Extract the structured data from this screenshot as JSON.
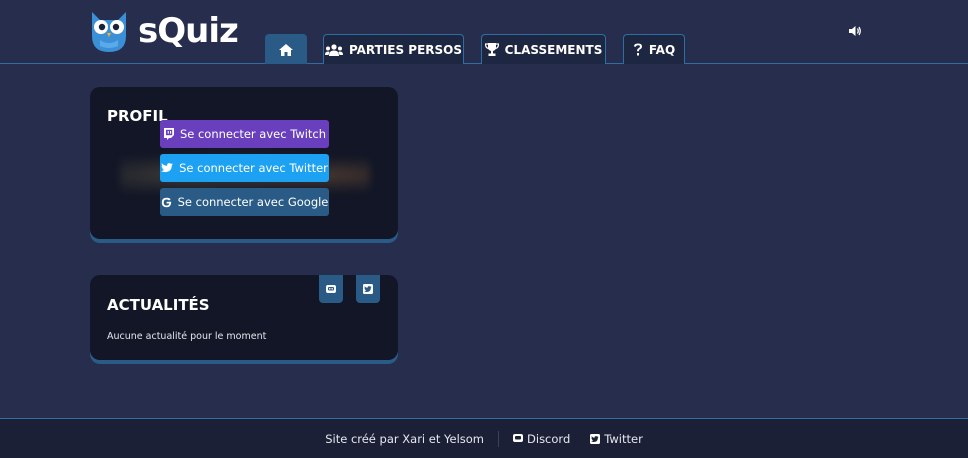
{
  "brand": {
    "name": "sQuiz"
  },
  "nav": {
    "tabs": [
      {
        "label": "",
        "icon": "home-icon",
        "active": true
      },
      {
        "label": "PARTIES PERSOS",
        "icon": "users-icon"
      },
      {
        "label": "CLASSEMENTS",
        "icon": "trophy-icon"
      },
      {
        "label": "FAQ",
        "icon": "question-icon"
      }
    ],
    "sound_icon": "volume-icon"
  },
  "profile": {
    "title": "PROFIL",
    "buttons": {
      "twitch": "Se connecter avec Twitch",
      "twitter": "Se connecter avec Twitter",
      "google": "Se connecter avec Google"
    }
  },
  "news": {
    "title": "ACTUALITÉS",
    "empty_text": "Aucune actualité pour le moment",
    "social_icons": [
      "discord-icon",
      "twitter-icon"
    ]
  },
  "footer": {
    "credit": "Site créé par Xari et Yelsom",
    "discord_label": "Discord",
    "twitter_label": "Twitter"
  },
  "colors": {
    "background": "#262d4d",
    "card": "#121626",
    "accent": "#2a5b86",
    "twitch": "#6a3fbd",
    "twitter": "#1da1f2"
  }
}
